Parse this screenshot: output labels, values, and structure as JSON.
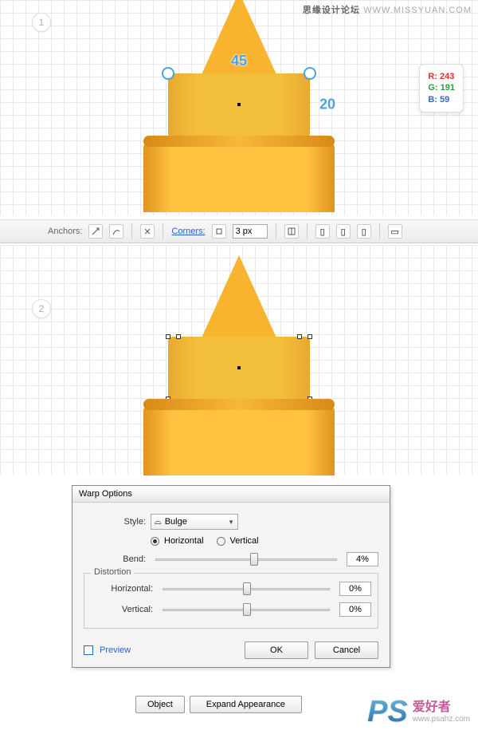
{
  "watermark_top": {
    "brand": "思缘设计论坛",
    "url": "WWW.MISSYUAN.COM"
  },
  "watermark_bottom": {
    "logo": "PS",
    "title": "爱好者",
    "url": "www.psahz.com"
  },
  "step1": {
    "number": "1",
    "width": "45",
    "height": "20",
    "rgb": {
      "r": "R: 243",
      "g": "G: 191",
      "b": "B: 59"
    }
  },
  "step2": {
    "number": "2"
  },
  "toolbar": {
    "anchors": "Anchors:",
    "corners": "Corners:",
    "corner_value": "3 px"
  },
  "dialog": {
    "title": "Warp Options",
    "style_label": "Style:",
    "style_value": "Bulge",
    "horizontal": "Horizontal",
    "vertical": "Vertical",
    "bend_label": "Bend:",
    "bend_value": "4%",
    "distortion_label": "Distortion",
    "dist_h_label": "Horizontal:",
    "dist_h_value": "0%",
    "dist_v_label": "Vertical:",
    "dist_v_value": "0%",
    "preview": "Preview",
    "ok": "OK",
    "cancel": "Cancel"
  },
  "bottom": {
    "object": "Object",
    "expand": "Expand Appearance"
  }
}
